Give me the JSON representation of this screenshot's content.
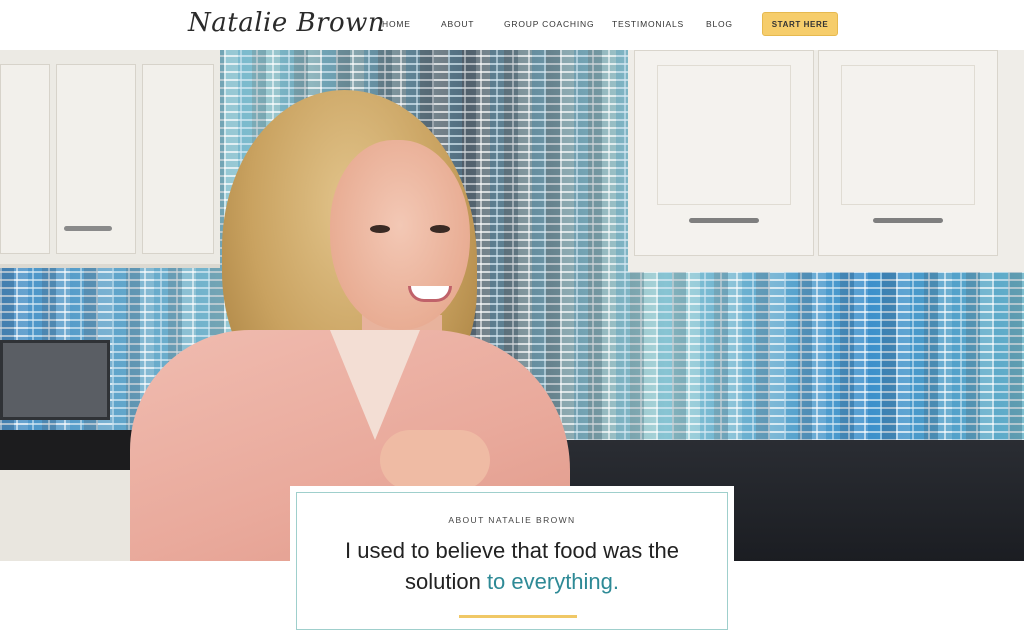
{
  "header": {
    "logo": "Natalie Brown",
    "nav": [
      "HOME",
      "ABOUT",
      "GROUP COACHING",
      "TESTIMONIALS",
      "BLOG"
    ],
    "cta": "START HERE"
  },
  "hero": {
    "image_alt": "Smiling woman with blonde curly hair in pink cardigan in a kitchen"
  },
  "card": {
    "eyebrow": "ABOUT NATALIE BROWN",
    "headline_line1": "I used to believe that food was the",
    "headline_line2_plain": "solution",
    "headline_line2_accent": "to everything."
  },
  "colors": {
    "accent": "#2e8a96",
    "cta": "#f6cd6b",
    "underline": "#f0c866",
    "card_border": "#9fcfcc"
  }
}
